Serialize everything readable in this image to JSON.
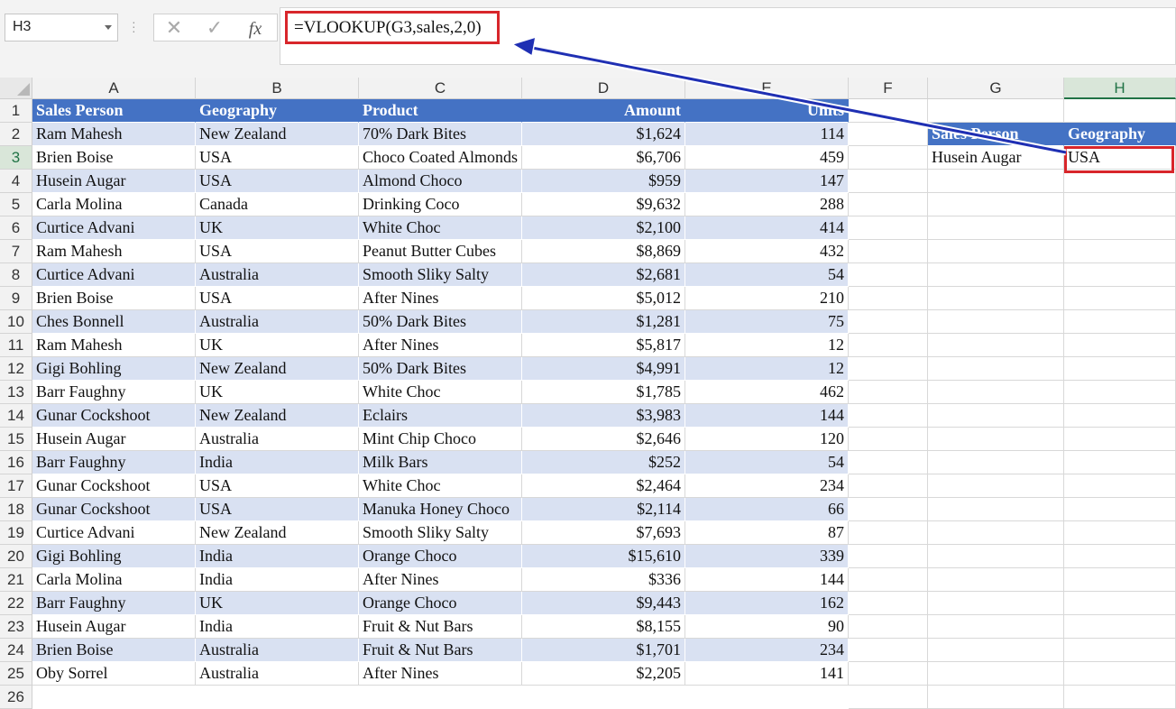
{
  "name_box": {
    "value": "H3"
  },
  "formula_buttons": {
    "cancel": "✕",
    "enter": "✓",
    "fx": "fx"
  },
  "formula": {
    "text": "=VLOOKUP(G3,sales,2,0)"
  },
  "columns": [
    "A",
    "B",
    "C",
    "D",
    "E",
    "F",
    "G",
    "H"
  ],
  "selected_column": "H",
  "selected_row": "3",
  "table": {
    "headers": [
      "Sales Person",
      "Geography",
      "Product",
      "Amount",
      "Units"
    ],
    "rows": [
      [
        "Ram Mahesh",
        "New Zealand",
        "70% Dark Bites",
        "$1,624",
        "114"
      ],
      [
        "Brien Boise",
        "USA",
        "Choco Coated Almonds",
        "$6,706",
        "459"
      ],
      [
        "Husein Augar",
        "USA",
        "Almond Choco",
        "$959",
        "147"
      ],
      [
        "Carla Molina",
        "Canada",
        "Drinking Coco",
        "$9,632",
        "288"
      ],
      [
        "Curtice Advani",
        "UK",
        "White Choc",
        "$2,100",
        "414"
      ],
      [
        "Ram Mahesh",
        "USA",
        "Peanut Butter Cubes",
        "$8,869",
        "432"
      ],
      [
        "Curtice Advani",
        "Australia",
        "Smooth Sliky Salty",
        "$2,681",
        "54"
      ],
      [
        "Brien Boise",
        "USA",
        "After Nines",
        "$5,012",
        "210"
      ],
      [
        "Ches Bonnell",
        "Australia",
        "50% Dark Bites",
        "$1,281",
        "75"
      ],
      [
        "Ram Mahesh",
        "UK",
        "After Nines",
        "$5,817",
        "12"
      ],
      [
        "Gigi Bohling",
        "New Zealand",
        "50% Dark Bites",
        "$4,991",
        "12"
      ],
      [
        "Barr Faughny",
        "UK",
        "White Choc",
        "$1,785",
        "462"
      ],
      [
        "Gunar Cockshoot",
        "New Zealand",
        "Eclairs",
        "$3,983",
        "144"
      ],
      [
        "Husein Augar",
        "Australia",
        "Mint Chip Choco",
        "$2,646",
        "120"
      ],
      [
        "Barr Faughny",
        "India",
        "Milk Bars",
        "$252",
        "54"
      ],
      [
        "Gunar Cockshoot",
        "USA",
        "White Choc",
        "$2,464",
        "234"
      ],
      [
        "Gunar Cockshoot",
        "USA",
        "Manuka Honey Choco",
        "$2,114",
        "66"
      ],
      [
        "Curtice Advani",
        "New Zealand",
        "Smooth Sliky Salty",
        "$7,693",
        "87"
      ],
      [
        "Gigi Bohling",
        "India",
        "Orange Choco",
        "$15,610",
        "339"
      ],
      [
        "Carla Molina",
        "India",
        "After Nines",
        "$336",
        "144"
      ],
      [
        "Barr Faughny",
        "UK",
        "Orange Choco",
        "$9,443",
        "162"
      ],
      [
        "Husein Augar",
        "India",
        "Fruit & Nut Bars",
        "$8,155",
        "90"
      ],
      [
        "Brien Boise",
        "Australia",
        "Fruit & Nut Bars",
        "$1,701",
        "234"
      ],
      [
        "Oby Sorrel",
        "Australia",
        "After Nines",
        "$2,205",
        "141"
      ]
    ]
  },
  "lookup": {
    "headers": [
      "Sales Person",
      "Geography"
    ],
    "values": [
      "Husein Augar",
      "USA"
    ]
  },
  "colors": {
    "header_blue": "#4472c4",
    "band_blue": "#d9e1f2",
    "highlight_red": "#d8262b",
    "arrow_blue": "#1f2fb3"
  }
}
